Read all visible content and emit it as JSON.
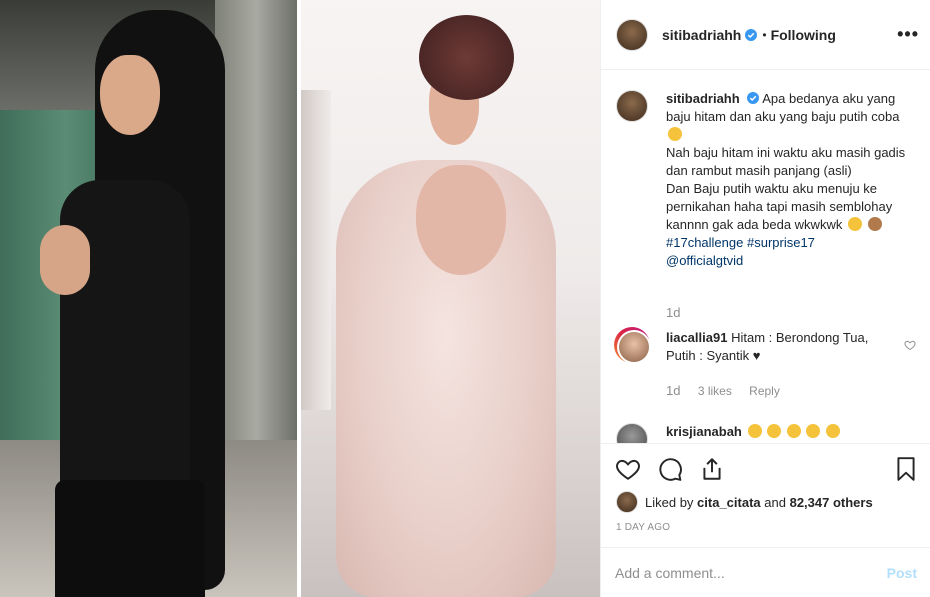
{
  "header": {
    "username": "sitibadriahh",
    "separator": "•",
    "follow_status": "Following",
    "more_label": "•••"
  },
  "caption": {
    "username": "sitibadriahh",
    "line1": "Apa bedanya aku yang baju hitam dan aku yang baju putih coba",
    "line2": "Nah baju hitam ini waktu aku masih gadis dan rambut masih panjang (asli)",
    "line3": "Dan Baju putih waktu aku menuju ke pernikahan haha tapi masih semblohay kannnn gak ada beda wkwkwk",
    "tag1": "#17challenge",
    "tag2": "#surprise17",
    "mention": "@officialgtvid",
    "time": "1d"
  },
  "comments": [
    {
      "username": "liacallia91",
      "text": "Hitam : Berondong Tua, Putih : Syantik ♥",
      "time": "1d",
      "likes": "3 likes",
      "reply": "Reply"
    },
    {
      "username": "krisjianabah",
      "text": ""
    }
  ],
  "likes": {
    "prefix": "Liked by",
    "user": "cita_citata",
    "and": "and",
    "count": "82,347 others"
  },
  "timeago": "1 DAY AGO",
  "add_comment": {
    "placeholder": "Add a comment...",
    "post_label": "Post"
  },
  "colors": {
    "verified": "#3897f0",
    "link": "#003569",
    "post_disabled": "#b2dffc",
    "muted": "#8e8e8e"
  }
}
